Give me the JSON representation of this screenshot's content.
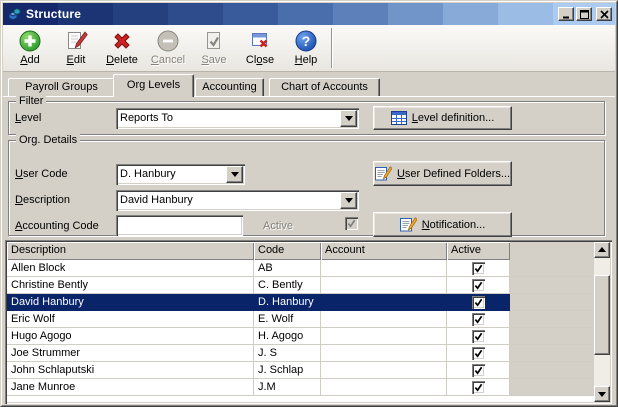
{
  "window": {
    "title": "Structure",
    "controls": [
      {
        "id": "minimize",
        "icon": "minimize-icon"
      },
      {
        "id": "maximize",
        "icon": "maximize-icon"
      },
      {
        "id": "close",
        "icon": "close-icon"
      }
    ]
  },
  "toolbar": {
    "buttons": [
      {
        "id": "add",
        "label": {
          "pre": "",
          "key": "A",
          "post": "dd"
        },
        "icon": "add-icon",
        "disabled": false
      },
      {
        "id": "edit",
        "label": {
          "pre": "",
          "key": "E",
          "post": "dit"
        },
        "icon": "edit-icon",
        "disabled": false
      },
      {
        "id": "delete",
        "label": {
          "pre": "",
          "key": "D",
          "post": "elete"
        },
        "icon": "delete-icon",
        "disabled": false
      },
      {
        "id": "cancel",
        "label": {
          "pre": "",
          "key": "C",
          "post": "ancel"
        },
        "icon": "cancel-icon",
        "disabled": true
      },
      {
        "id": "save",
        "label": {
          "pre": "",
          "key": "S",
          "post": "ave"
        },
        "icon": "save-icon",
        "disabled": true
      },
      {
        "id": "close",
        "label": {
          "pre": "Cl",
          "key": "o",
          "post": "se"
        },
        "icon": "closewin-icon",
        "disabled": false
      },
      {
        "id": "help",
        "label": {
          "pre": "",
          "key": "H",
          "post": "elp"
        },
        "icon": "help-icon",
        "disabled": false
      }
    ]
  },
  "tabs": [
    {
      "id": "payroll-groups",
      "label": "Payroll Groups",
      "active": false
    },
    {
      "id": "org-levels",
      "label": "Org Levels",
      "active": true
    },
    {
      "id": "accounting",
      "label": "Accounting",
      "active": false
    },
    {
      "id": "chart-of-accounts",
      "label": "Chart of Accounts",
      "active": false
    }
  ],
  "filter": {
    "legend": "Filter",
    "level_label": {
      "pre": "",
      "key": "L",
      "post": "evel"
    },
    "level_value": "Reports To",
    "level_definition_button": {
      "pre": "",
      "key": "L",
      "post": "evel definition..."
    }
  },
  "org_details": {
    "legend": "Org. Details",
    "user_code_label": {
      "pre": "",
      "key": "U",
      "post": "ser Code"
    },
    "user_code_value": "D. Hanbury",
    "description_label": {
      "pre": "",
      "key": "D",
      "post": "escription"
    },
    "description_value": "David Hanbury",
    "accounting_code_label": {
      "pre": "",
      "key": "A",
      "post": "ccounting Code"
    },
    "accounting_code_value": "",
    "active_label": "Active",
    "active_checked": true,
    "user_defined_folders_button": {
      "pre": "",
      "key": "U",
      "post": "ser Defined Folders..."
    },
    "notification_button": {
      "pre": "",
      "key": "N",
      "post": "otification..."
    }
  },
  "grid": {
    "columns": [
      "Description",
      "Code",
      "Account",
      "Active"
    ],
    "rows": [
      {
        "description": "Allen Block",
        "code": "AB",
        "account": "",
        "active": true,
        "selected": false
      },
      {
        "description": "Christine Bently",
        "code": "C. Bently",
        "account": "",
        "active": true,
        "selected": false
      },
      {
        "description": "David Hanbury",
        "code": "D. Hanbury",
        "account": "",
        "active": true,
        "selected": true
      },
      {
        "description": "Eric Wolf",
        "code": "E. Wolf",
        "account": "",
        "active": true,
        "selected": false
      },
      {
        "description": "Hugo Agogo",
        "code": "H. Agogo",
        "account": "",
        "active": true,
        "selected": false
      },
      {
        "description": "Joe Strummer",
        "code": "J. S",
        "account": "",
        "active": true,
        "selected": false
      },
      {
        "description": "John Schlaputski",
        "code": "J. Schlap",
        "account": "",
        "active": true,
        "selected": false
      },
      {
        "description": "Jane Munroe",
        "code": "J.M",
        "account": "",
        "active": true,
        "selected": false
      }
    ]
  },
  "colors": {
    "chrome": "#d4d0c8",
    "selection": "#0a246a",
    "titlebar_left": "#14286b",
    "titlebar_right": "#abcbf0"
  }
}
